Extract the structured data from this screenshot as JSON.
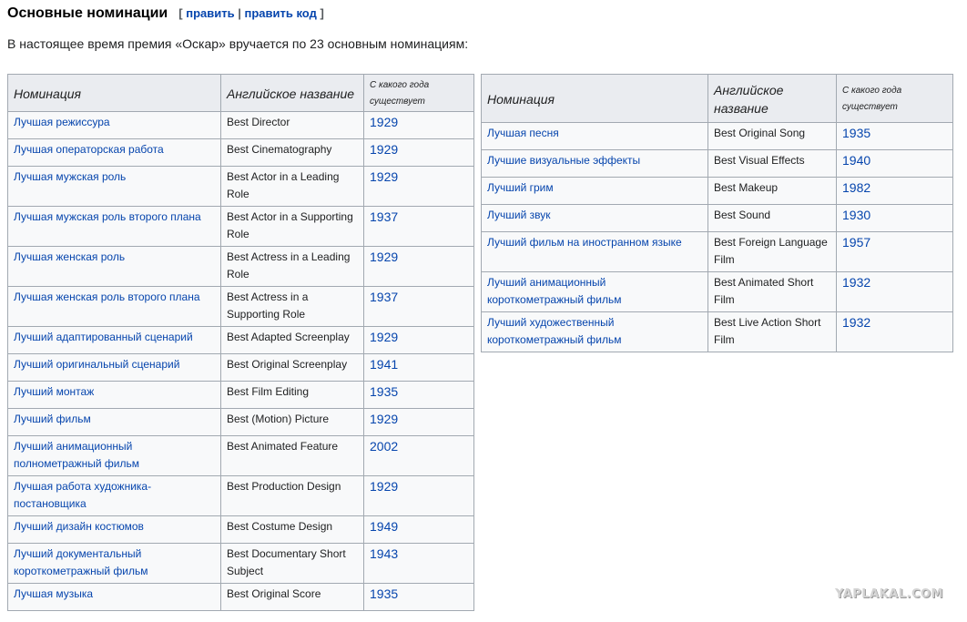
{
  "heading": {
    "title": "Основные номинации",
    "bracket_open": "[",
    "edit_link": "править",
    "separator": "|",
    "edit_source_link": "править код",
    "bracket_close": "]"
  },
  "intro": "В настоящее время премия «Оскар» вручается по 23 основным номинациям:",
  "columns": {
    "nomination": "Номинация",
    "english": "Английское название",
    "since": "С какого года существует"
  },
  "table_left": [
    {
      "nomination": "Лучшая режиссура",
      "english": "Best Director",
      "year": "1929"
    },
    {
      "nomination": "Лучшая операторская работа",
      "english": "Best Cinematography",
      "year": "1929"
    },
    {
      "nomination": "Лучшая мужская роль",
      "english": "Best Actor in a Leading Role",
      "year": "1929"
    },
    {
      "nomination": "Лучшая мужская роль второго плана",
      "english": "Best Actor in a Supporting Role",
      "year": "1937"
    },
    {
      "nomination": "Лучшая женская роль",
      "english": "Best Actress in a Leading Role",
      "year": "1929"
    },
    {
      "nomination": "Лучшая женская роль второго плана",
      "english": "Best Actress in a Supporting Role",
      "year": "1937"
    },
    {
      "nomination": "Лучший адаптированный сценарий",
      "english": "Best Adapted Screenplay",
      "year": "1929"
    },
    {
      "nomination": "Лучший оригинальный сценарий",
      "english": "Best Original Screenplay",
      "year": "1941"
    },
    {
      "nomination": "Лучший монтаж",
      "english": "Best Film Editing",
      "year": "1935"
    },
    {
      "nomination": "Лучший фильм",
      "english": "Best (Motion) Picture",
      "year": "1929"
    },
    {
      "nomination": "Лучший анимационный полнометражный фильм",
      "english": "Best Animated Feature",
      "year": "2002"
    },
    {
      "nomination": "Лучшая работа художника-постановщика",
      "english": "Best Production Design",
      "year": "1929"
    },
    {
      "nomination": "Лучший дизайн костюмов",
      "english": "Best Costume Design",
      "year": "1949"
    },
    {
      "nomination": "Лучший документальный короткометражный фильм",
      "english": "Best Documentary Short Subject",
      "year": "1943"
    },
    {
      "nomination": "Лучшая музыка",
      "english": "Best Original Score",
      "year": "1935"
    }
  ],
  "table_right": [
    {
      "nomination": "Лучшая песня",
      "english": "Best Original Song",
      "year": "1935"
    },
    {
      "nomination": "Лучшие визуальные эффекты",
      "english": "Best Visual Effects",
      "year": "1940"
    },
    {
      "nomination": "Лучший грим",
      "english": "Best Makeup",
      "year": "1982"
    },
    {
      "nomination": "Лучший звук",
      "english": "Best Sound",
      "year": "1930"
    },
    {
      "nomination": "Лучший фильм на иностранном языке",
      "english": "Best Foreign Language Film",
      "year": "1957"
    },
    {
      "nomination": "Лучший анимационный короткометражный фильм",
      "english": "Best Animated Short Film",
      "year": "1932"
    },
    {
      "nomination": "Лучший художественный короткометражный фильм",
      "english": "Best Live Action Short Film",
      "year": "1932"
    }
  ],
  "watermark": "YAPLAKAL.COM",
  "colors": {
    "link": "#0645ad",
    "header_bg": "#eaecf0",
    "cell_bg": "#f8f9fa",
    "border": "#a2a9b1",
    "text": "#202122"
  }
}
